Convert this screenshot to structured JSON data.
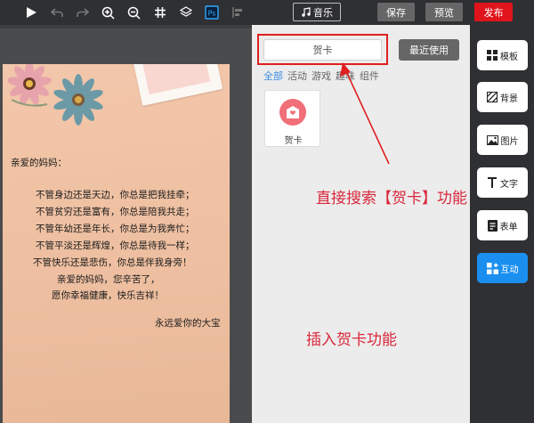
{
  "toolbar": {
    "icons": [
      "play-icon",
      "undo-icon",
      "redo-icon",
      "zoom-in-icon",
      "zoom-out-icon",
      "grid-icon",
      "layers-icon",
      "ps-icon",
      "align-icon"
    ],
    "ps_label": "Ps"
  },
  "header": {
    "music_label": "音乐",
    "save_label": "保存",
    "preview_label": "预览",
    "publish_label": "发布",
    "publish_color": "#e0151c"
  },
  "card": {
    "greeting": "亲爱的妈妈：",
    "lines": [
      "不管身边还是天边，你总是把我挂牵；",
      "不管贫穷还是富有，你总是陪我共走；",
      "不管年幼还是年长，你总是为我奔忙；",
      "不管平淡还是辉煌，你总是待我一样；",
      "不管快乐还是悲伤，你总是伴我身旁！",
      "亲爱的妈妈，您辛苦了，",
      "愿你幸福健康，快乐吉祥！"
    ],
    "signature": "永远爱你的大宝"
  },
  "panel": {
    "search_value": "贺卡",
    "recent_label": "最近使用",
    "categories": [
      "全部",
      "活动",
      "游戏",
      "趣味",
      "组件"
    ],
    "active_category": "全部",
    "result": {
      "label": "贺卡",
      "icon": "greeting-card-icon"
    },
    "annotation_search": "直接搜索【贺卡】功能",
    "annotation_insert": "插入贺卡功能",
    "annotation_color": "#d9283c"
  },
  "sidebar": {
    "items": [
      {
        "label": "模板",
        "icon": "template-icon"
      },
      {
        "label": "背景",
        "icon": "background-icon"
      },
      {
        "label": "图片",
        "icon": "image-icon"
      },
      {
        "label": "文字",
        "icon": "text-icon"
      },
      {
        "label": "表单",
        "icon": "form-icon"
      },
      {
        "label": "互动",
        "icon": "interaction-icon"
      }
    ],
    "active_item": "互动",
    "accent_color": "#1b8ff0"
  }
}
